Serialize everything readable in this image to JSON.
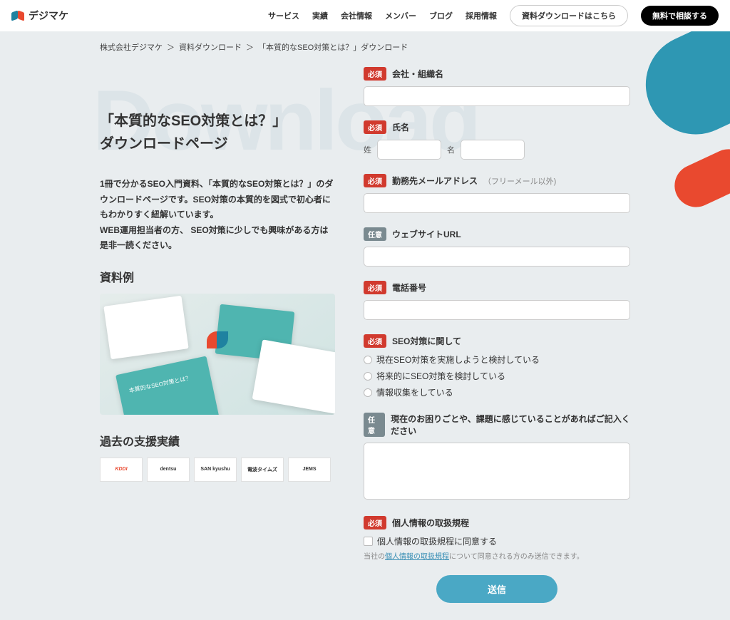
{
  "header": {
    "brand": "デジマケ",
    "nav": {
      "service": "サービス",
      "works": "実績",
      "company": "会社情報",
      "members": "メンバー",
      "blog": "ブログ",
      "recruit": "採用情報"
    },
    "cta_download": "資料ダウンロードはこちら",
    "cta_consult": "無料で相談する"
  },
  "breadcrumb": {
    "b1": "株式会社デジマケ",
    "sep": "＞",
    "b2": "資料ダウンロード",
    "b3": "「本質的なSEO対策とは？」ダウンロード"
  },
  "bg_word": "Download",
  "left": {
    "title_line1": "「本質的なSEO対策とは？」",
    "title_line2": "ダウンロードページ",
    "desc": "1冊で分かるSEO入門資料、「本質的なSEO対策とは？」のダウンロードページです。SEO対策の本質的を図式で初心者にもわかりすく紐解いています。\nWEB運用担当者の方、 SEO対策に少しでも興味がある方は是非一読ください。",
    "subhead_sample": "資料例",
    "subhead_clients": "過去の支援実績",
    "logos": {
      "l1": "KDDI",
      "l2": "dentsu",
      "l3": "SAN kyushu",
      "l4": "電波タイムズ",
      "l5": "JEMS"
    }
  },
  "form": {
    "badge_required": "必須",
    "badge_optional": "任意",
    "company_label": "会社・組織名",
    "name_label": "氏名",
    "name_sei": "姓",
    "name_mei": "名",
    "email_label": "勤務先メールアドレス",
    "email_hint": "（フリーメール以外)",
    "website_label": "ウェブサイトURL",
    "phone_label": "電話番号",
    "seo_label": "SEO対策に関して",
    "seo_opt1": "現在SEO対策を実施しようと検討している",
    "seo_opt2": "将来的にSEO対策を検討している",
    "seo_opt3": "情報収集をしている",
    "issue_label": "現在のお困りごとや、課題に感じていることがあればご記入ください",
    "privacy_label": "個人情報の取扱規程",
    "privacy_check": "個人情報の取扱規程に同意する",
    "privacy_fine_pre": "当社の",
    "privacy_fine_link": "個人情報の取扱規程",
    "privacy_fine_post": "について同意される方のみ送信できます。",
    "submit": "送信"
  }
}
